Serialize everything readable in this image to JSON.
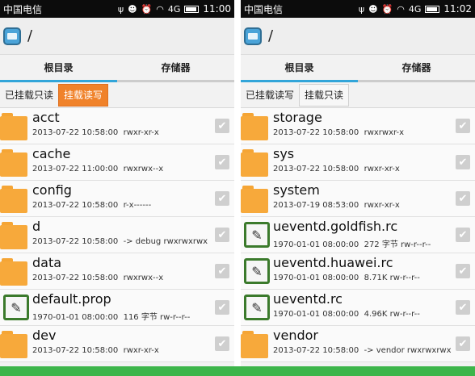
{
  "left": {
    "status": {
      "carrier": "中国电信",
      "usb": "ψ",
      "cat": "☻",
      "alarm": "⏰",
      "wifi": "◠",
      "signal": "4G",
      "time": "11:00"
    },
    "path": "/",
    "tabs": [
      "根目录",
      "存储器"
    ],
    "mount": {
      "ro": "已挂载只读",
      "rw": "挂载读写"
    },
    "rows": [
      {
        "type": "folder",
        "name": "acct",
        "date": "2013-07-22 10:58:00",
        "extra": "rwxr-xr-x"
      },
      {
        "type": "folder",
        "name": "cache",
        "date": "2013-07-22 11:00:00",
        "extra": "rwxrwx--x"
      },
      {
        "type": "folder",
        "name": "config",
        "date": "2013-07-22 10:58:00",
        "extra": "r-x------"
      },
      {
        "type": "folder",
        "name": "d",
        "date": "2013-07-22 10:58:00",
        "extra": "-> debug  rwxrwxrwx"
      },
      {
        "type": "folder",
        "name": "data",
        "date": "2013-07-22 10:58:00",
        "extra": "rwxrwx--x"
      },
      {
        "type": "file",
        "name": "default.prop",
        "date": "1970-01-01 08:00:00",
        "extra": "116 字节  rw-r--r--"
      },
      {
        "type": "folder",
        "name": "dev",
        "date": "2013-07-22 10:58:00",
        "extra": "rwxr-xr-x"
      }
    ]
  },
  "right": {
    "status": {
      "carrier": "中国电信",
      "usb": "ψ",
      "cat": "☻",
      "alarm": "⏰",
      "wifi": "◠",
      "signal": "4G",
      "time": "11:02"
    },
    "path": "/",
    "tabs": [
      "根目录",
      "存储器"
    ],
    "mount": {
      "rw": "已挂载读写",
      "ro": "挂载只读"
    },
    "rows": [
      {
        "type": "folder",
        "name": "storage",
        "date": "2013-07-22 10:58:00",
        "extra": "rwxrwxr-x"
      },
      {
        "type": "folder",
        "name": "sys",
        "date": "2013-07-22 10:58:00",
        "extra": "rwxr-xr-x"
      },
      {
        "type": "folder",
        "name": "system",
        "date": "2013-07-19 08:53:00",
        "extra": "rwxr-xr-x"
      },
      {
        "type": "file",
        "name": "ueventd.goldfish.rc",
        "date": "1970-01-01 08:00:00",
        "extra": "272 字节  rw-r--r--"
      },
      {
        "type": "file",
        "name": "ueventd.huawei.rc",
        "date": "1970-01-01 08:00:00",
        "extra": "8.71K  rw-r--r--"
      },
      {
        "type": "file",
        "name": "ueventd.rc",
        "date": "1970-01-01 08:00:00",
        "extra": "4.96K  rw-r--r--"
      },
      {
        "type": "folder",
        "name": "vendor",
        "date": "2013-07-22 10:58:00",
        "extra": "-> vendor  rwxrwxrwx"
      }
    ]
  },
  "icons": {
    "check": "✔",
    "edit": "✎"
  }
}
